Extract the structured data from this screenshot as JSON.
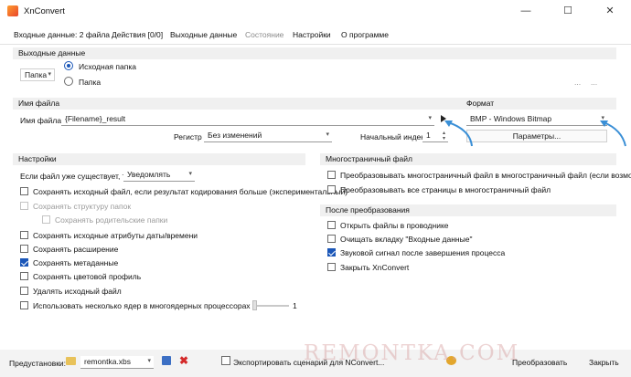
{
  "window": {
    "title": "XnConvert",
    "minimize": "—",
    "maximize": "☐",
    "close": "✕"
  },
  "tabs": [
    {
      "label": "Входные данные: 2 файла",
      "enabled": true
    },
    {
      "label": "Действия [0/0]",
      "enabled": true
    },
    {
      "label": "Выходные данные",
      "enabled": true
    },
    {
      "label": "Состояние",
      "enabled": false
    },
    {
      "label": "Настройки",
      "enabled": true
    },
    {
      "label": "О программе",
      "enabled": true
    }
  ],
  "output": {
    "header": "Выходные данные",
    "target_select": "Папка",
    "radio_source": "Исходная папка",
    "radio_folder": "Папка",
    "folder_ellipsis": "...",
    "folder_more": "..."
  },
  "filename": {
    "header": "Имя файла",
    "label": "Имя файла",
    "value": "{Filename}_result",
    "case_label": "Регистр",
    "case_value": "Без изменений",
    "start_index_label": "Начальный индекс",
    "start_index_value": "1"
  },
  "format": {
    "header": "Формат",
    "value": "BMP - Windows Bitmap",
    "params_button": "Параметры..."
  },
  "settings": {
    "header": "Настройки",
    "if_exists_label": "Если файл уже существует, то",
    "if_exists_value": "Уведомлять",
    "items": [
      {
        "label": "Сохранять исходный файл, если результат кодирования больше (экспериментальный)",
        "checked": false,
        "enabled": true
      },
      {
        "label": "Сохранять структуру папок",
        "checked": false,
        "enabled": false
      },
      {
        "label": "Сохранять родительские папки",
        "checked": false,
        "enabled": false
      },
      {
        "label": "Сохранять исходные атрибуты даты/времени",
        "checked": false,
        "enabled": true
      },
      {
        "label": "Сохранять расширение",
        "checked": false,
        "enabled": true
      },
      {
        "label": "Сохранять метаданные",
        "checked": true,
        "enabled": true
      },
      {
        "label": "Сохранять цветовой профиль",
        "checked": false,
        "enabled": true
      },
      {
        "label": "Удалять исходный файл",
        "checked": false,
        "enabled": true
      },
      {
        "label": "Использовать несколько ядер в многоядерных процессорах",
        "checked": false,
        "enabled": true
      }
    ],
    "cores_value": "1"
  },
  "multipage": {
    "header": "Многостраничный файл",
    "items": [
      {
        "label": "Преобразовывать многостраничный файл в многостраничный файл (если возможно)",
        "checked": false
      },
      {
        "label": "Преобразовывать все страницы в многостраничный файл",
        "checked": false
      }
    ]
  },
  "after": {
    "header": "После преобразования",
    "items": [
      {
        "label": "Открыть файлы в проводнике",
        "checked": false
      },
      {
        "label": "Очищать вкладку \"Входные данные\"",
        "checked": false
      },
      {
        "label": "Звуковой сигнал после завершения процесса",
        "checked": true
      },
      {
        "label": "Закрыть XnConvert",
        "checked": false
      }
    ]
  },
  "bottom": {
    "presets_label": "Предустановки:",
    "preset_value": "remontka.xbs",
    "export_button": "Экспортировать сценарий для NConvert...",
    "convert_button": "Преобразовать",
    "close_button": "Закрыть"
  },
  "watermark": "REMONTKA.COM",
  "colors": {
    "accent": "#1a56b8",
    "group_header_bg": "#f0f0f0",
    "bottom_bar_bg": "#f3f3f3",
    "annotation_arrow": "#3a8fd6"
  }
}
